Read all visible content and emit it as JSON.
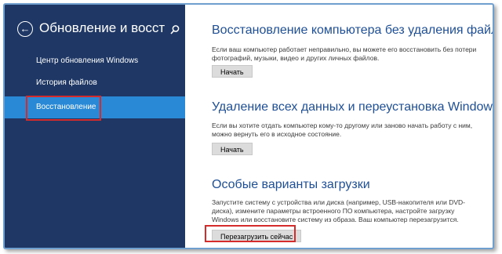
{
  "sidebar": {
    "title": "Обновление и восстан...",
    "items": [
      {
        "label": "Центр обновления Windows"
      },
      {
        "label": "История файлов"
      },
      {
        "label": "Восстановление"
      }
    ]
  },
  "sections": [
    {
      "title": "Восстановление компьютера без удаления файлов",
      "description": "Если ваш компьютер работает неправильно, вы можете его восстановить без потери фотографий, музыки, видео и других личных файлов.",
      "button": "Начать"
    },
    {
      "title": "Удаление всех данных и переустановка Windows",
      "description": "Если вы хотите отдать компьютер кому-то другому или заново начать работу с ним, можно вернуть его в исходное состояние.",
      "button": "Начать"
    },
    {
      "title": "Особые варианты загрузки",
      "description": "Запустите систему с устройства или диска (например, USB-накопителя или DVD-диска), измените параметры встроенного ПО компьютера, настройте загрузку Windows или восстановите систему из образа. Ваш компьютер перезагрузится.",
      "button": "Перезагрузить сейчас"
    }
  ],
  "colors": {
    "sidebar_bg": "#1e3765",
    "selected_bg": "#2a89d6",
    "title_blue": "#1e4f96",
    "highlight_red": "#d62b2b"
  },
  "icons": {
    "back": "back-arrow-icon",
    "search": "search-icon"
  }
}
